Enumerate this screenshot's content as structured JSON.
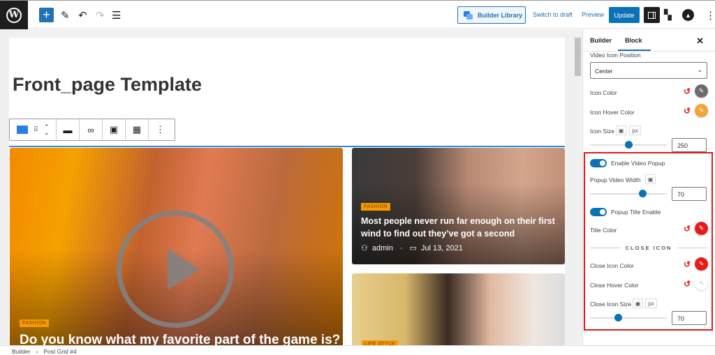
{
  "topbar": {
    "logo": "W",
    "add_label": "+",
    "builder_library": "Builder Library",
    "switch_to_draft": "Switch to draft",
    "preview": "Preview",
    "update": "Update"
  },
  "page": {
    "title": "Front_page Template"
  },
  "posts": [
    {
      "category": "FASHION",
      "title": "Do you know what my favorite part of the game is?"
    },
    {
      "category": "FASHION",
      "title": "Most people never run far enough on their first wind to find out they’ve got a second",
      "author": "admin",
      "date": "Jul 13, 2021"
    },
    {
      "category": "LIFE STYLE"
    }
  ],
  "sidebar": {
    "tabs": [
      "Builder",
      "Block"
    ],
    "active_tab": "Block",
    "close": "✕",
    "video_icon_position_label": "Video Icon Position",
    "video_icon_position_value": "Center",
    "icon_color_label": "Icon Color",
    "icon_hover_color_label": "Icon Hover Color",
    "icon_size_label": "Icon Size",
    "icon_size_unit": "px",
    "icon_size_value": "250",
    "enable_video_popup_label": "Enable Video Popup",
    "enable_video_popup": true,
    "popup_video_width_label": "Popup Video Width",
    "popup_video_width_value": "70",
    "popup_title_enable_label": "Popup Title Enable",
    "popup_title_enable": true,
    "title_color_label": "Title Color",
    "close_icon_heading": "CLOSE ICON",
    "close_icon_color_label": "Close Icon Color",
    "close_hover_color_label": "Close Hover Color",
    "close_icon_size_label": "Close Icon Size",
    "close_icon_size_unit": "px",
    "close_icon_size_value": "70",
    "colors": {
      "icon_color": "#6b6b6b",
      "icon_hover_color": "#f2a33a",
      "title_color": "#e81b1b",
      "close_icon_color": "#e81b1b",
      "close_hover_color": "#ffffff"
    }
  },
  "breadcrumb": [
    "Builder",
    "›",
    "Post Grid #4"
  ]
}
